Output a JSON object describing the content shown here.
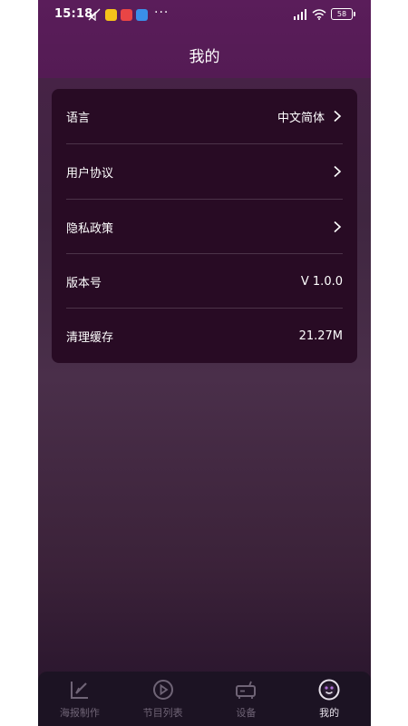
{
  "status_bar": {
    "time": "15:18",
    "more": "···",
    "battery": "58"
  },
  "header": {
    "title": "我的"
  },
  "settings": [
    {
      "label": "语言",
      "value": "中文简体",
      "has_chevron": true
    },
    {
      "label": "用户协议",
      "value": "",
      "has_chevron": true
    },
    {
      "label": "隐私政策",
      "value": "",
      "has_chevron": true
    },
    {
      "label": "版本号",
      "value": "V 1.0.0",
      "has_chevron": false
    },
    {
      "label": "清理缓存",
      "value": "21.27M",
      "has_chevron": false
    }
  ],
  "bottom_nav": {
    "active": "我的",
    "items": [
      {
        "label": "海报制作",
        "icon": "poster-edit-icon"
      },
      {
        "label": "节目列表",
        "icon": "play-circle-icon"
      },
      {
        "label": "设备",
        "icon": "device-box-icon"
      },
      {
        "label": "我的",
        "icon": "profile-face-icon"
      }
    ]
  },
  "colors": {
    "header_bg": "#541b54",
    "card_bg": "#280b24",
    "nav_bg": "#1c1323",
    "nav_inactive": "#6f6476",
    "nav_active": "#e6e0ea"
  }
}
